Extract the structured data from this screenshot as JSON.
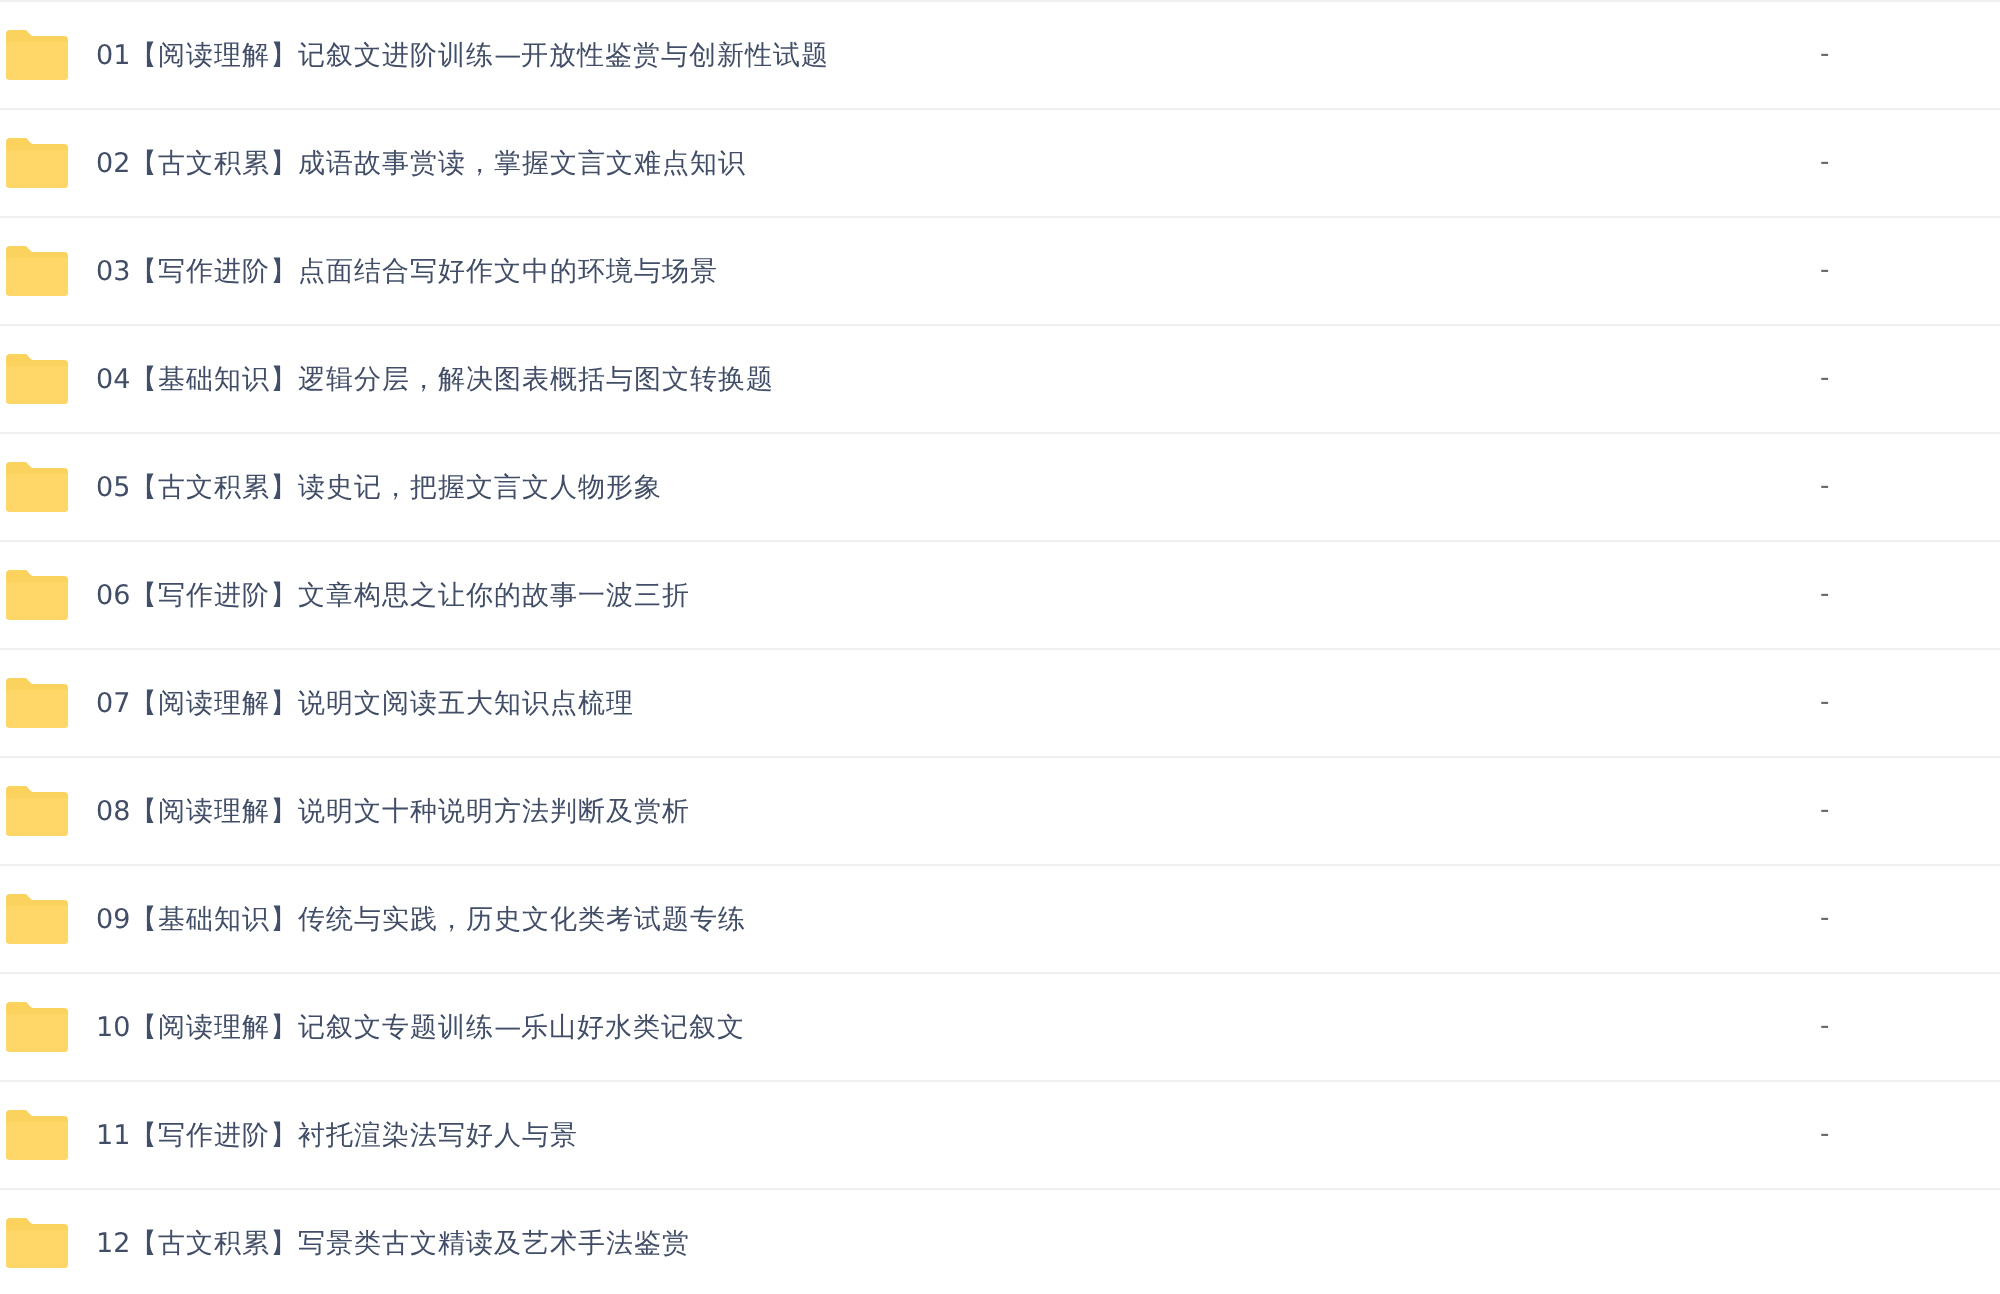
{
  "files": [
    {
      "name": "01【阅读理解】记叙文进阶训练—开放性鉴赏与创新性试题",
      "size": "-"
    },
    {
      "name": "02【古文积累】成语故事赏读，掌握文言文难点知识",
      "size": "-"
    },
    {
      "name": "03【写作进阶】点面结合写好作文中的环境与场景",
      "size": "-"
    },
    {
      "name": "04【基础知识】逻辑分层，解决图表概括与图文转换题",
      "size": "-"
    },
    {
      "name": "05【古文积累】读史记，把握文言文人物形象",
      "size": "-"
    },
    {
      "name": "06【写作进阶】文章构思之让你的故事一波三折",
      "size": "-"
    },
    {
      "name": "07【阅读理解】说明文阅读五大知识点梳理",
      "size": "-"
    },
    {
      "name": "08【阅读理解】说明文十种说明方法判断及赏析",
      "size": "-"
    },
    {
      "name": "09【基础知识】传统与实践，历史文化类考试题专练",
      "size": "-"
    },
    {
      "name": "10【阅读理解】记叙文专题训练—乐山好水类记叙文",
      "size": "-"
    },
    {
      "name": "11【写作进阶】衬托渲染法写好人与景",
      "size": "-"
    },
    {
      "name": "12【古文积累】写景类古文精读及艺术手法鉴赏"
    }
  ]
}
